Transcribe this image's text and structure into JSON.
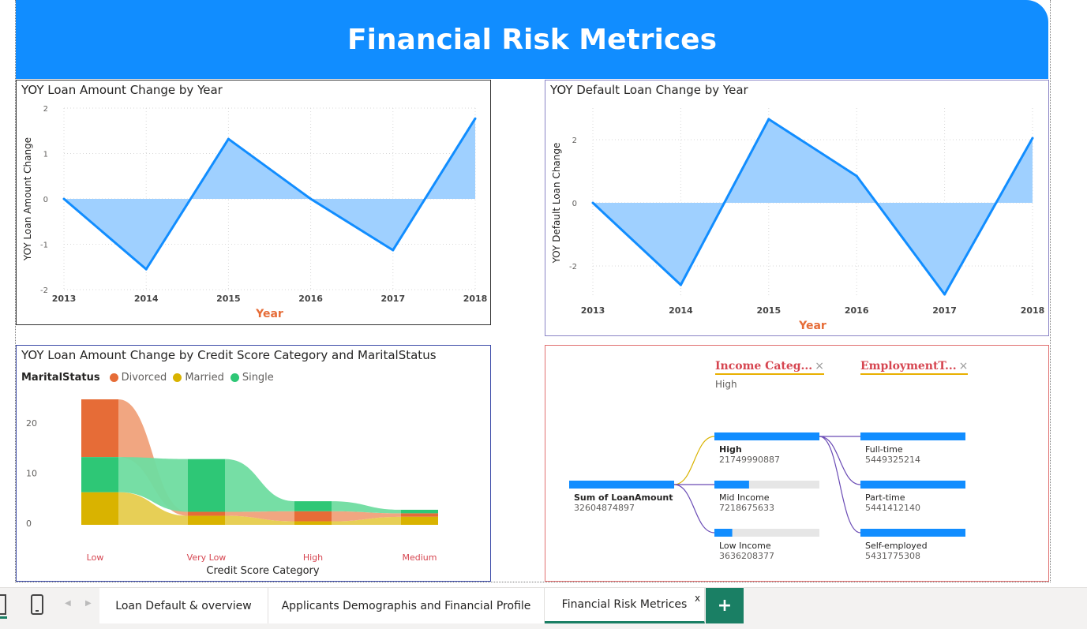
{
  "page": {
    "title": "Financial Risk Metrices"
  },
  "chart_data": [
    {
      "type": "area",
      "title": "YOY Loan Amount Change by Year",
      "xlabel": "Year",
      "ylabel": "YOY Loan Amount Change",
      "x": [
        "2013",
        "2014",
        "2015",
        "2016",
        "2017",
        "2018"
      ],
      "values": [
        0,
        -1.55,
        1.32,
        0,
        -1.13,
        1.77
      ],
      "ylim": [
        -2,
        2
      ],
      "yticks": [
        "2",
        "1",
        "0",
        "-1",
        "-2"
      ],
      "color": "#118dff",
      "fill": "#9fd0ff"
    },
    {
      "type": "area",
      "title": "YOY Default Loan Change by Year",
      "xlabel": "Year",
      "ylabel": "YOY Default Loan Change",
      "x": [
        "2013",
        "2014",
        "2015",
        "2016",
        "2017",
        "2018"
      ],
      "values": [
        0,
        -2.6,
        2.65,
        0.85,
        -2.9,
        2.05
      ],
      "ylim": [
        -3,
        3
      ],
      "yticks": [
        "2",
        "0",
        "-2"
      ],
      "color": "#118dff",
      "fill": "#9fd0ff"
    },
    {
      "type": "bar",
      "title": "YOY Loan Amount Change by Credit Score Category and MaritalStatus",
      "xlabel": "Credit Score Category",
      "ylabel": "",
      "legend_title": "MaritalStatus",
      "categories": [
        "Low",
        "Very Low",
        "High",
        "Medium"
      ],
      "series": [
        {
          "name": "Divorced",
          "color": "#e66c37",
          "values": [
            11.5,
            0.8,
            2.0,
            0.7
          ]
        },
        {
          "name": "Married",
          "color": "#d9b300",
          "values": [
            6.5,
            1.8,
            0.7,
            1.6
          ]
        },
        {
          "name": "Single",
          "color": "#2ec776",
          "values": [
            7.0,
            10.5,
            2.0,
            0.7
          ]
        }
      ],
      "ylim": [
        0,
        25
      ],
      "yticks": [
        "20",
        "10",
        "0"
      ]
    }
  ],
  "decomp": {
    "col1": {
      "title": "Income Categ...",
      "filter": "High"
    },
    "col2": {
      "title": "EmploymentT..."
    },
    "root": {
      "label": "Sum of LoanAmount",
      "value": "32604874897"
    },
    "income": [
      {
        "label": "High",
        "value": "21749990887",
        "fill": 1.0
      },
      {
        "label": "Mid Income",
        "value": "7218675633",
        "fill": 0.33
      },
      {
        "label": "Low Income",
        "value": "3636208377",
        "fill": 0.17
      }
    ],
    "employment": [
      {
        "label": "Full-time",
        "value": "5449325214",
        "fill": 1.0
      },
      {
        "label": "Part-time",
        "value": "5441412140",
        "fill": 1.0
      },
      {
        "label": "Self-employed",
        "value": "5431775308",
        "fill": 1.0
      }
    ]
  },
  "tabs": [
    {
      "label": "Loan Default & overview"
    },
    {
      "label": "Applicants Demographis and Financial Profile"
    },
    {
      "label": "Financial Risk Metrices",
      "close": "x"
    }
  ],
  "add_tab": "+"
}
